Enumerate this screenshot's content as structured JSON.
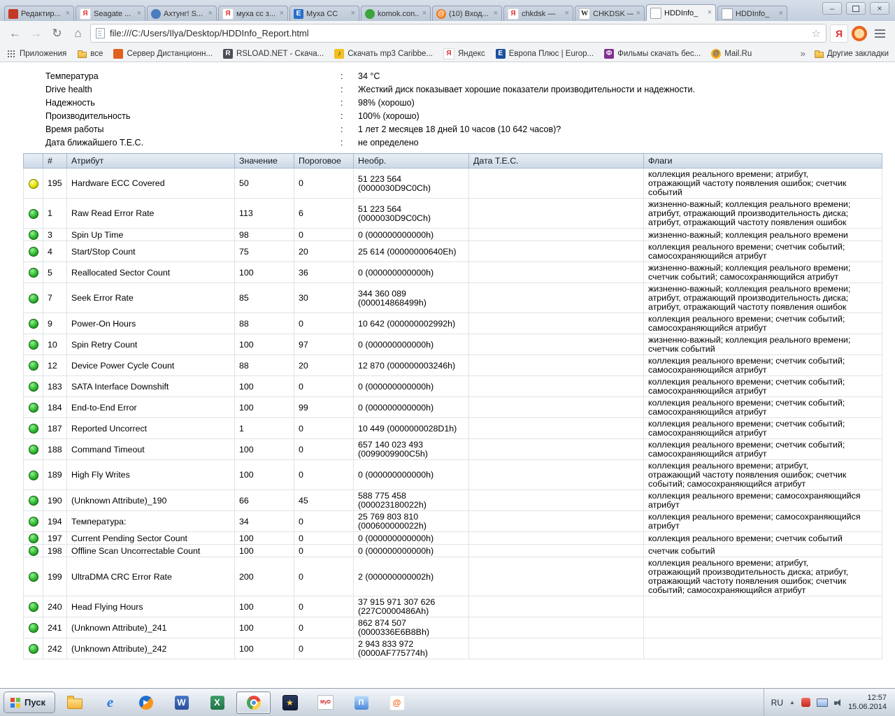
{
  "colors": {
    "led_green": "#2eb82e",
    "led_yellow": "#e2e200",
    "header_bg": "#ccd9e7",
    "frame": "#c3cedd"
  },
  "browser": {
    "tab_close_glyph": "×",
    "window": {
      "minimize_glyph": "–",
      "close_glyph": "×"
    },
    "tabs": [
      {
        "label": "Редактир...",
        "icon": "red-doc"
      },
      {
        "label": "Seagate ...",
        "icon": "yandex"
      },
      {
        "label": "Ахтунг! S...",
        "icon": "blue-globe"
      },
      {
        "label": "муха сс з...",
        "icon": "yandex"
      },
      {
        "label": "Муха СС",
        "icon": "e-blue"
      },
      {
        "label": "komok.con...",
        "icon": "green-dot"
      },
      {
        "label": "(10) Вход...",
        "icon": "orange-at"
      },
      {
        "label": "chkdsk —",
        "icon": "yandex"
      },
      {
        "label": "CHKDSK —",
        "icon": "wikipedia"
      },
      {
        "label": "HDDInfo_",
        "icon": "page",
        "active": true
      },
      {
        "label": "HDDInfo_",
        "icon": "page"
      }
    ],
    "toolbar": {
      "back_glyph": "←",
      "forward_glyph": "→",
      "reload_glyph": "↻",
      "home_glyph": "⌂",
      "star_glyph": "☆",
      "yandex_glyph": "Я"
    },
    "address": "file:///C:/Users/Ilya/Desktop/HDDInfo_Report.html",
    "bookmarks_bar": {
      "items": [
        {
          "label": "Приложения",
          "icon": "apps-grid"
        },
        {
          "label": "все",
          "icon": "folder"
        },
        {
          "label": "Сервер Дистанционн...",
          "icon": "orange-dot"
        },
        {
          "label": "RSLOAD.NET - Скача...",
          "icon": "rs"
        },
        {
          "label": "Скачать mp3 Caribbe...",
          "icon": "music"
        },
        {
          "label": "Яндекс",
          "icon": "yandex"
        },
        {
          "label": "Европа Плюс | Europ...",
          "icon": "europa"
        },
        {
          "label": "Фильмы скачать бес...",
          "icon": "film"
        },
        {
          "label": "Mail.Ru",
          "icon": "mail"
        }
      ],
      "overflow_chevron": "»",
      "other_bookmarks": "Другие закладки"
    }
  },
  "report": {
    "summary": [
      {
        "label": "Температура",
        "value": "34 °C"
      },
      {
        "label": "Drive health",
        "value": "Жесткий диск показывает хорошие показатели производительности и надежности."
      },
      {
        "label": "Надежность",
        "value": "98% (хорошо)"
      },
      {
        "label": "Производительность",
        "value": "100% (хорошо)"
      },
      {
        "label": "Время работы",
        "value": "1 лет 2 месяцев 18 дней 10 часов (10 642 часов)?"
      },
      {
        "label": "Дата ближайшего T.E.C.",
        "value": "не определено"
      }
    ],
    "table": {
      "headers": [
        "",
        "#",
        "Атрибут",
        "Значение",
        "Пороговое",
        "Необр.",
        "Дата T.E.C.",
        "Флаги"
      ],
      "rows": [
        {
          "led": "yellow",
          "num": "195",
          "attr": "Hardware ECC Covered",
          "value": "50",
          "threshold": "0",
          "raw": "51 223 564\n(0000030D9C0Ch)",
          "tec": "",
          "flags": "коллекция реального времени; атрибут,\nотражающий частоту появления ошибок; счетчик\nсобытий"
        },
        {
          "led": "green",
          "num": "1",
          "attr": "Raw Read Error Rate",
          "value": "113",
          "threshold": "6",
          "raw": "51 223 564\n(0000030D9C0Ch)",
          "tec": "",
          "flags": "жизненно-важный; коллекция реального времени;\nатрибут, отражающий производительность диска;\nатрибут, отражающий частоту появления ошибок"
        },
        {
          "led": "green",
          "num": "3",
          "attr": "Spin Up Time",
          "value": "98",
          "threshold": "0",
          "raw": "0 (000000000000h)",
          "tec": "",
          "flags": "жизненно-важный; коллекция реального времени"
        },
        {
          "led": "green",
          "num": "4",
          "attr": "Start/Stop Count",
          "value": "75",
          "threshold": "20",
          "raw": "25 614 (00000000640Eh)",
          "tec": "",
          "flags": "коллекция реального времени; счетчик событий;\nсамосохраняющийся атрибут"
        },
        {
          "led": "green",
          "num": "5",
          "attr": "Reallocated Sector Count",
          "value": "100",
          "threshold": "36",
          "raw": "0 (000000000000h)",
          "tec": "",
          "flags": "жизненно-важный; коллекция реального времени;\nсчетчик событий; самосохраняющийся атрибут"
        },
        {
          "led": "green",
          "num": "7",
          "attr": "Seek Error Rate",
          "value": "85",
          "threshold": "30",
          "raw": "344 360 089\n(000014868499h)",
          "tec": "",
          "flags": "жизненно-важный; коллекция реального времени;\nатрибут, отражающий производительность диска;\nатрибут, отражающий частоту появления ошибок"
        },
        {
          "led": "green",
          "num": "9",
          "attr": "Power-On Hours",
          "value": "88",
          "threshold": "0",
          "raw": "10 642 (000000002992h)",
          "tec": "",
          "flags": "коллекция реального времени; счетчик событий;\nсамосохраняющийся атрибут"
        },
        {
          "led": "green",
          "num": "10",
          "attr": "Spin Retry Count",
          "value": "100",
          "threshold": "97",
          "raw": "0 (000000000000h)",
          "tec": "",
          "flags": "жизненно-важный; коллекция реального времени;\nсчетчик событий"
        },
        {
          "led": "green",
          "num": "12",
          "attr": "Device Power Cycle Count",
          "value": "88",
          "threshold": "20",
          "raw": "12 870 (000000003246h)",
          "tec": "",
          "flags": "коллекция реального времени; счетчик событий;\nсамосохраняющийся атрибут"
        },
        {
          "led": "green",
          "num": "183",
          "attr": "SATA Interface Downshift",
          "value": "100",
          "threshold": "0",
          "raw": "0 (000000000000h)",
          "tec": "",
          "flags": "коллекция реального времени; счетчик событий;\nсамосохраняющийся атрибут"
        },
        {
          "led": "green",
          "num": "184",
          "attr": "End-to-End Error",
          "value": "100",
          "threshold": "99",
          "raw": "0 (000000000000h)",
          "tec": "",
          "flags": "коллекция реального времени; счетчик событий;\nсамосохраняющийся атрибут"
        },
        {
          "led": "green",
          "num": "187",
          "attr": "Reported Uncorrect",
          "value": "1",
          "threshold": "0",
          "raw": "10 449 (0000000028D1h)",
          "tec": "",
          "flags": "коллекция реального времени; счетчик событий;\nсамосохраняющийся атрибут"
        },
        {
          "led": "green",
          "num": "188",
          "attr": "Command Timeout",
          "value": "100",
          "threshold": "0",
          "raw": "657 140 023 493\n(0099009900C5h)",
          "tec": "",
          "flags": "коллекция реального времени; счетчик событий;\nсамосохраняющийся атрибут"
        },
        {
          "led": "green",
          "num": "189",
          "attr": "High Fly Writes",
          "value": "100",
          "threshold": "0",
          "raw": "0 (000000000000h)",
          "tec": "",
          "flags": "коллекция реального времени; атрибут,\nотражающий частоту появления ошибок; счетчик\nсобытий; самосохраняющийся атрибут"
        },
        {
          "led": "green",
          "num": "190",
          "attr": "(Unknown Attribute)_190",
          "value": "66",
          "threshold": "45",
          "raw": "588 775 458\n(000023180022h)",
          "tec": "",
          "flags": "коллекция реального времени; самосохраняющийся\nатрибут"
        },
        {
          "led": "green",
          "num": "194",
          "attr": "Температура:",
          "value": "34",
          "threshold": "0",
          "raw": "25 769 803 810\n(000600000022h)",
          "tec": "",
          "flags": "коллекция реального времени; самосохраняющийся\nатрибут"
        },
        {
          "led": "green",
          "num": "197",
          "attr": "Current Pending Sector Count",
          "value": "100",
          "threshold": "0",
          "raw": "0 (000000000000h)",
          "tec": "",
          "flags": "коллекция реального времени; счетчик событий"
        },
        {
          "led": "green",
          "num": "198",
          "attr": "Offline Scan Uncorrectable Count",
          "value": "100",
          "threshold": "0",
          "raw": "0 (000000000000h)",
          "tec": "",
          "flags": "счетчик событий"
        },
        {
          "led": "green",
          "num": "199",
          "attr": "UltraDMA CRC Error Rate",
          "value": "200",
          "threshold": "0",
          "raw": "2 (000000000002h)",
          "tec": "",
          "flags": "коллекция реального времени; атрибут,\nотражающий производительность диска; атрибут,\nотражающий частоту появления ошибок; счетчик\nсобытий; самосохраняющийся атрибут"
        },
        {
          "led": "green",
          "num": "240",
          "attr": "Head Flying Hours",
          "value": "100",
          "threshold": "0",
          "raw": "37 915 971 307 626\n(227C0000486Ah)",
          "tec": "",
          "flags": ""
        },
        {
          "led": "green",
          "num": "241",
          "attr": "(Unknown Attribute)_241",
          "value": "100",
          "threshold": "0",
          "raw": "862 874 507\n(0000336E6B8Bh)",
          "tec": "",
          "flags": ""
        },
        {
          "led": "green",
          "num": "242",
          "attr": "(Unknown Attribute)_242",
          "value": "100",
          "threshold": "0",
          "raw": "2 943 833 972\n(0000AF775774h)",
          "tec": "",
          "flags": ""
        }
      ]
    }
  },
  "taskbar": {
    "start_label": "Пуск",
    "buttons": [
      {
        "icon": "explorer"
      },
      {
        "icon": "ie"
      },
      {
        "icon": "media-player"
      },
      {
        "icon": "word"
      },
      {
        "icon": "excel"
      },
      {
        "icon": "chrome",
        "active": true
      },
      {
        "icon": "star-app"
      },
      {
        "icon": "myd"
      },
      {
        "icon": "blue-app"
      },
      {
        "icon": "orange-app"
      }
    ],
    "tray": {
      "language": "RU",
      "expand_glyph": "▲",
      "clock_time": "12:57",
      "clock_date": "15.06.2014"
    }
  }
}
